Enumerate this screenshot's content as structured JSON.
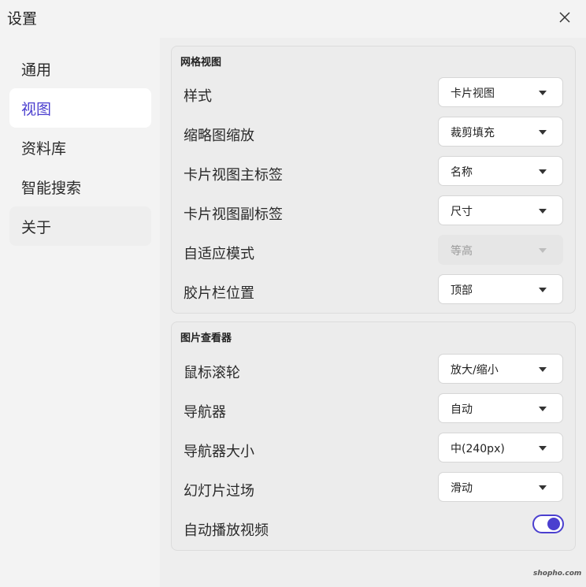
{
  "window": {
    "title": "设置"
  },
  "sidebar": {
    "items": [
      {
        "label": "通用"
      },
      {
        "label": "视图"
      },
      {
        "label": "资料库"
      },
      {
        "label": "智能搜索"
      },
      {
        "label": "关于"
      }
    ],
    "active_index": 1
  },
  "grid_view": {
    "title": "网格视图",
    "rows": [
      {
        "label": "样式",
        "value": "卡片视图"
      },
      {
        "label": "缩略图缩放",
        "value": "裁剪填充"
      },
      {
        "label": "卡片视图主标签",
        "value": "名称"
      },
      {
        "label": "卡片视图副标签",
        "value": "尺寸"
      },
      {
        "label": "自适应模式",
        "value": "等高",
        "disabled": true
      },
      {
        "label": "胶片栏位置",
        "value": "顶部"
      }
    ]
  },
  "image_viewer": {
    "title": "图片查看器",
    "rows": [
      {
        "label": "鼠标滚轮",
        "value": "放大/缩小"
      },
      {
        "label": "导航器",
        "value": "自动"
      },
      {
        "label": "导航器大小",
        "value": "中(240px)"
      },
      {
        "label": "幻灯片过场",
        "value": "滑动"
      }
    ],
    "autoplay": {
      "label": "自动播放视频",
      "enabled": true
    }
  },
  "accent_color": "#4b3fcf",
  "icons": {
    "close": "close-icon",
    "dropdown": "chevron-down-icon"
  },
  "watermark": "shopho.com"
}
